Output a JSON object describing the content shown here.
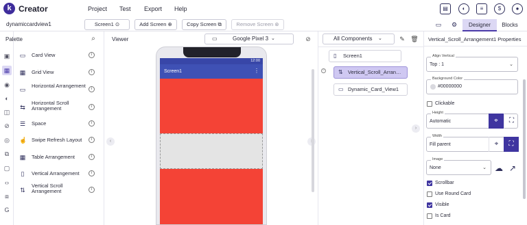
{
  "app": {
    "logo_letter": "k",
    "brand": "Creator"
  },
  "menu": [
    "Project",
    "Test",
    "Export",
    "Help"
  ],
  "top_icons": [
    "folder-icon",
    "palette-icon",
    "news-icon",
    "dollar-icon",
    "user-icon"
  ],
  "toolbar": {
    "project_name": "dynamiccardview1",
    "screen_select": "Screen1",
    "add_screen": "Add Screen",
    "copy_screen": "Copy Screen",
    "remove_screen": "Remove Screen",
    "tab_designer": "Designer",
    "tab_blocks": "Blocks"
  },
  "palette": {
    "title": "Palette",
    "items": [
      {
        "label": "Card View",
        "icon": "card-view-icon"
      },
      {
        "label": "Grid View",
        "icon": "grid-view-icon"
      },
      {
        "label": "Horizontal Arrangement",
        "icon": "horizontal-arrangement-icon"
      },
      {
        "label": "Horizontal Scroll Arrangement",
        "icon": "horizontal-scroll-icon"
      },
      {
        "label": "Space",
        "icon": "space-icon"
      },
      {
        "label": "Swipe Refresh Layout",
        "icon": "swipe-refresh-icon"
      },
      {
        "label": "Table Arrangement",
        "icon": "table-icon"
      },
      {
        "label": "Vertical Arrangement",
        "icon": "vertical-arrangement-icon"
      },
      {
        "label": "Vertical Scroll Arrangement",
        "icon": "vertical-scroll-icon"
      }
    ]
  },
  "viewer": {
    "title": "Viewer",
    "device": "Google Pixel 3",
    "status_time": "12:00",
    "screen_title": "Screen1"
  },
  "components": {
    "filter": "All Components",
    "tree": [
      "Screen1",
      "Vertical_Scroll_Arrangement1",
      "Dynamic_Card_View1"
    ]
  },
  "properties": {
    "title": "Vertical_Scroll_Arrangement1 Properties",
    "align_vertical_label": "Align Vertical",
    "align_vertical_value": "Top : 1",
    "bg_color_label": "Background Color",
    "bg_color_value": "#00000000",
    "clickable_label": "Clickable",
    "clickable": false,
    "height_label": "Height",
    "height_value": "Automatic",
    "width_label": "Width",
    "width_value": "Fill parent",
    "image_label": "Image",
    "image_value": "None",
    "scrollbar_label": "Scrollbar",
    "scrollbar": true,
    "use_round_card_label": "Use Round Card",
    "use_round_card": false,
    "visible_label": "Visible",
    "visible": true,
    "is_card_label": "Is Card",
    "is_card": false
  },
  "colors": {
    "accent": "#3f35a0",
    "screen_bg": "#f44336",
    "appbar": "#3f51b5",
    "selected_tab": "#dcd8f4"
  }
}
